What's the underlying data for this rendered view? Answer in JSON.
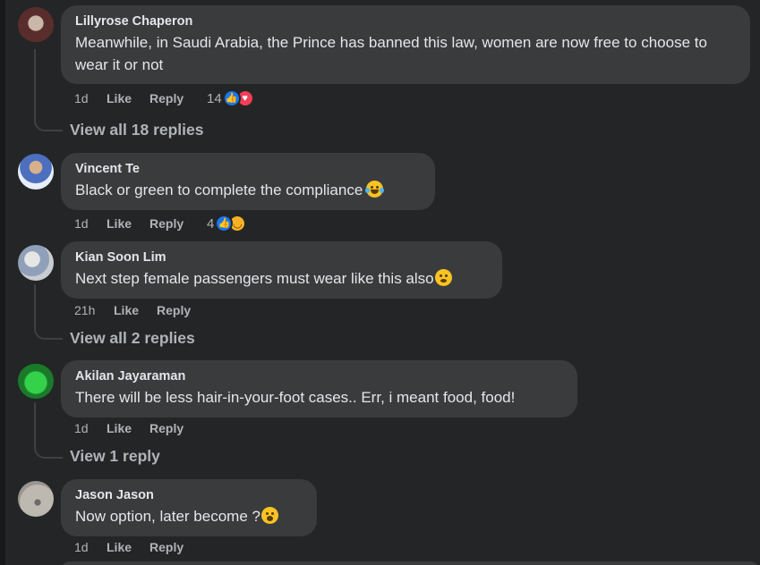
{
  "comments": [
    {
      "author": "Lillyrose Chaperon",
      "text": "Meanwhile, in Saudi Arabia, the Prince has banned this law, women are now free to choose to wear it or not",
      "time": "1d",
      "like": "Like",
      "reply": "Reply",
      "reaction_count": "14",
      "reactions": [
        "like-reaction-icon",
        "love-reaction-icon"
      ],
      "view_replies": "View all 18 replies"
    },
    {
      "author": "Vincent Te",
      "text": "Black or green to complete the compliance",
      "emoji": "laughing-tears-emoji",
      "time": "1d",
      "like": "Like",
      "reply": "Reply",
      "reaction_count": "4",
      "reactions": [
        "like-reaction-icon",
        "haha-reaction-icon"
      ]
    },
    {
      "author": "Kian Soon Lim",
      "text": "Next step female passengers must wear like this also",
      "emoji": "hand-over-mouth-emoji",
      "time": "21h",
      "like": "Like",
      "reply": "Reply",
      "view_replies": "View all 2 replies"
    },
    {
      "author": "Akilan Jayaraman",
      "text": "There will be less hair-in-your-foot cases.. Err, i meant food, food!",
      "time": "1d",
      "like": "Like",
      "reply": "Reply",
      "view_replies": "View 1 reply"
    },
    {
      "author": "Jason Jason",
      "text": "Now option, later become ?",
      "emoji": "screaming-face-emoji",
      "time": "1d",
      "like": "Like",
      "reply": "Reply"
    }
  ],
  "colors": {
    "background": "#242526",
    "bubble": "#3a3b3c",
    "primary_text": "#e4e6eb",
    "secondary_text": "#b0b3b8",
    "like_blue": "#1877f2",
    "love_red": "#f33e58"
  }
}
